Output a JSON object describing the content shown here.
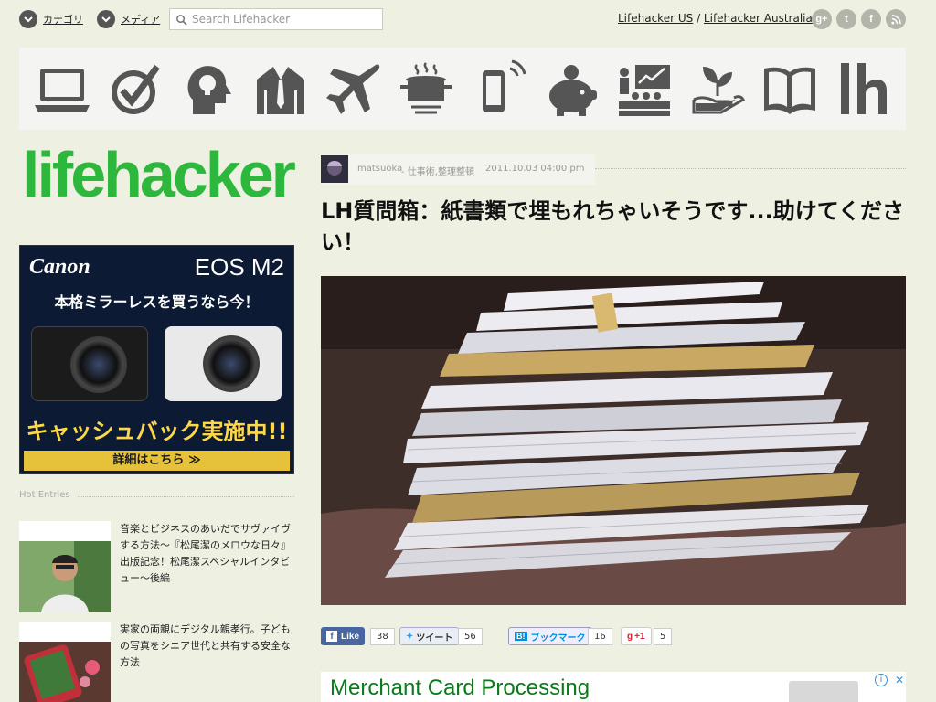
{
  "colors": {
    "background": "#eef0e1",
    "logo_green": "#2db83d",
    "icon_gray": "#555555"
  },
  "top": {
    "category_label": "カテゴリ",
    "media_label": "メディア",
    "search_placeholder": "Search Lifehacker",
    "edition_us": "Lifehacker US",
    "edition_sep": " / ",
    "edition_au": "Lifehacker Australia",
    "social": [
      "g+",
      "t",
      "f",
      "rss"
    ]
  },
  "categories": [
    "laptop-icon",
    "checkmark-icon",
    "idea-head-icon",
    "suit-icon",
    "airplane-icon",
    "cooking-pot-icon",
    "smartphone-icon",
    "piggy-bank-icon",
    "presentation-icon",
    "plant-hand-icon",
    "book-icon",
    "lh-icon"
  ],
  "logo": "lifehacker",
  "ad": {
    "brand": "Canon",
    "model": "EOS M2",
    "headline": "本格ミラーレスを買うなら今！",
    "cashback": "キャッシュバック実施中!!",
    "detail": "詳細はこちら ≫"
  },
  "hot_entries": {
    "title": "Hot Entries",
    "items": [
      {
        "text": "音楽とビジネスのあいだでサヴァイヴする方法〜『松尾潔のメロウな日々』出版記念！松尾潔スペシャルインタビュー〜後編"
      },
      {
        "text": "実家の両親にデジタル親孝行。子どもの写真をシニア世代と共有する安全な方法"
      }
    ]
  },
  "article": {
    "author": "matsuoka",
    "categories": "- 仕事術,整理整頓",
    "date": "2011.10.03 04:00 pm",
    "title": "LH質問箱：紙書類で埋もれちゃいそうです...助けてください！"
  },
  "share": {
    "fb_label": "Like",
    "fb_count": "38",
    "tw_label": "ツイート",
    "tw_count": "56",
    "hb_label": "ブックマーク",
    "hb_count": "16",
    "gp_label": "+1",
    "gp_count": "5"
  },
  "bottom_ad": {
    "title": "Merchant Card Processing"
  }
}
